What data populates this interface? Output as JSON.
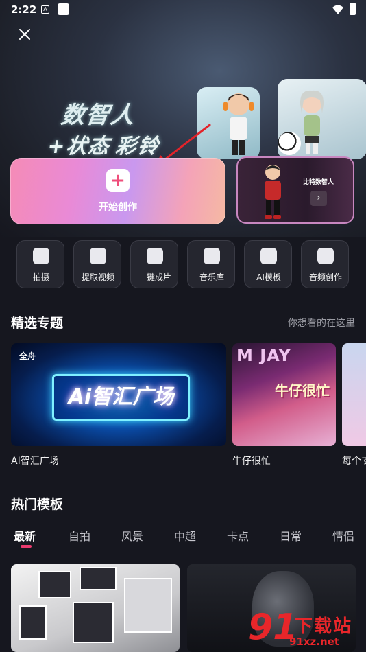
{
  "status_bar": {
    "time": "2:22",
    "notif_icon_letter": "A"
  },
  "banner": {
    "title": "数智人",
    "subtitle_part1": "+状态",
    "subtitle_part2": "彩铃"
  },
  "create_card": {
    "label": "开始创作",
    "icon": "plus-icon"
  },
  "avatar_card": {
    "label": "比特数智人",
    "icon": "chevron-right-icon"
  },
  "tools": [
    {
      "label": "拍摄",
      "icon": "camera-icon"
    },
    {
      "label": "提取视频",
      "icon": "video-icon"
    },
    {
      "label": "一键成片",
      "icon": "film-reel-icon"
    },
    {
      "label": "音乐库",
      "icon": "music-disc-icon"
    },
    {
      "label": "AI模板",
      "icon": "robot-icon"
    },
    {
      "label": "音频创作",
      "icon": "music-note-icon"
    }
  ],
  "featured": {
    "title": "精选专题",
    "more": "你想看的在这里",
    "items": [
      {
        "caption": "AI智汇广场",
        "badge": "全舟",
        "art_text": "Ai智汇广场"
      },
      {
        "caption": "牛仔很忙",
        "art_sign": "M  JAY",
        "art_text": "牛仔很忙"
      },
      {
        "caption": "每个す"
      }
    ]
  },
  "hot_templates": {
    "title": "热门模板",
    "tabs": [
      "最新",
      "自拍",
      "风景",
      "中超",
      "卡点",
      "日常",
      "情侣"
    ],
    "active_tab": "最新"
  },
  "watermark": {
    "number": "91",
    "text": "下载站",
    "url": "91xz.net"
  },
  "colors": {
    "accent": "#ea3b6f",
    "background": "#16171f",
    "watermark": "#e8262a"
  }
}
